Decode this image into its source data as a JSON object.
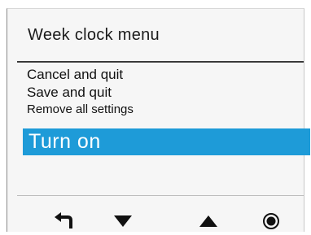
{
  "header": {
    "title": "Week clock menu"
  },
  "menu": {
    "items": [
      {
        "label": "Cancel and quit"
      },
      {
        "label": "Save and quit"
      },
      {
        "label": "Remove all settings"
      }
    ],
    "selected": {
      "label": "Turn on"
    }
  },
  "colors": {
    "highlight": "#1e9bd8",
    "icon": "#111111"
  },
  "buttons": [
    {
      "icon": "back-arrow-icon"
    },
    {
      "icon": "arrow-down-icon"
    },
    {
      "icon": "arrow-up-icon"
    },
    {
      "icon": "select-circle-icon"
    }
  ]
}
